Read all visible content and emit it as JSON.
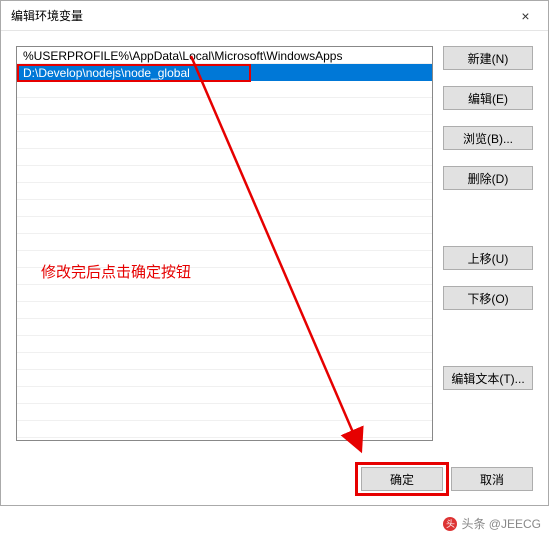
{
  "window": {
    "title": "编辑环境变量",
    "close_label": "×"
  },
  "list": {
    "items": [
      {
        "text": "%USERPROFILE%\\AppData\\Local\\Microsoft\\WindowsApps",
        "selected": false
      },
      {
        "text": "D:\\Develop\\nodejs\\node_global",
        "selected": true
      }
    ]
  },
  "buttons": {
    "new": "新建(N)",
    "edit": "编辑(E)",
    "browse": "浏览(B)...",
    "delete": "删除(D)",
    "move_up": "上移(U)",
    "move_down": "下移(O)",
    "edit_text": "编辑文本(T)...",
    "ok": "确定",
    "cancel": "取消"
  },
  "annotation": {
    "text": "修改完后点击确定按钮"
  },
  "watermark": {
    "text": "头条 @JEECG"
  }
}
